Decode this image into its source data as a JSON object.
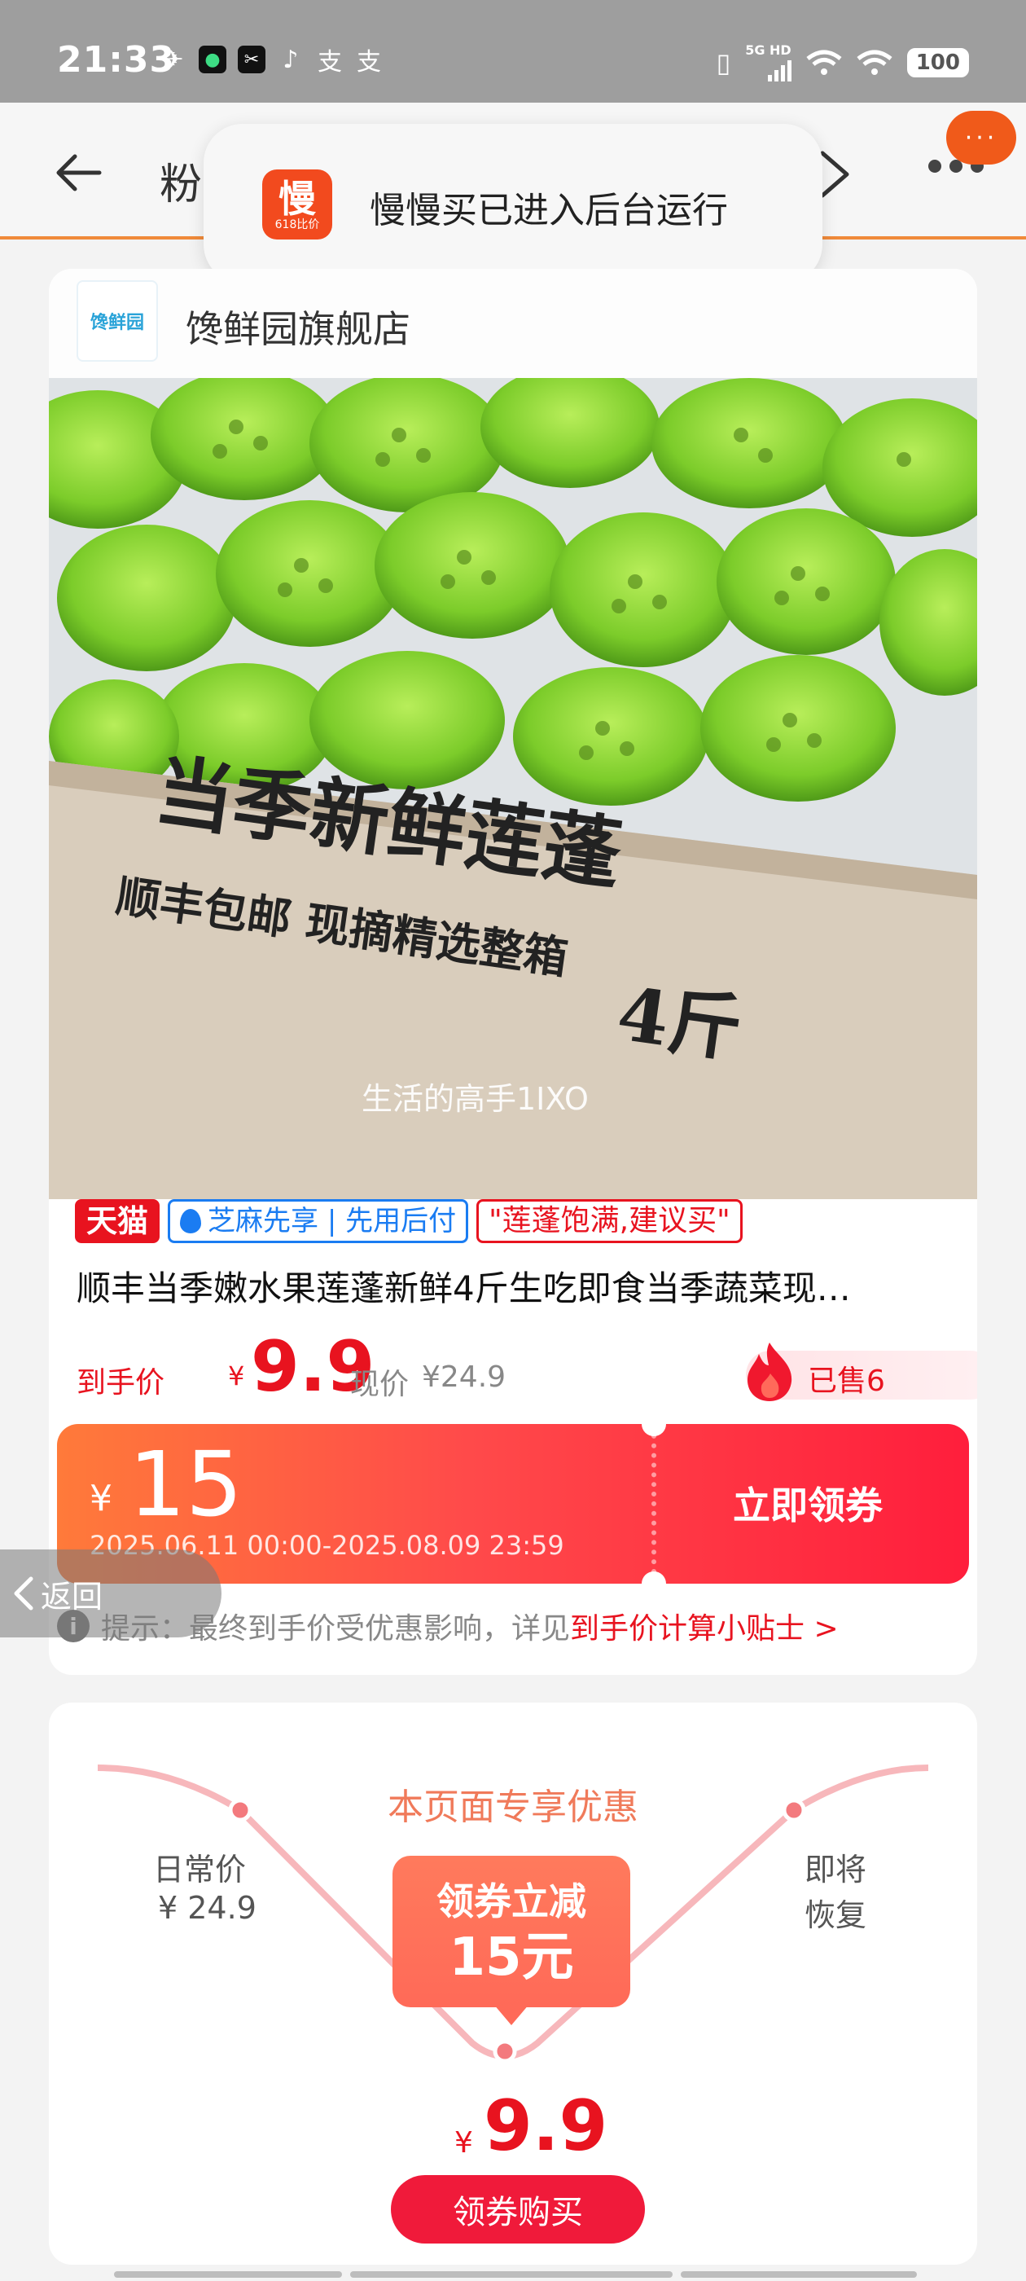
{
  "status_bar": {
    "time": "21:33",
    "network": "5G HD",
    "battery": "100",
    "app_icons": [
      "drone-icon",
      "app-green-icon",
      "capcut-icon",
      "tiktok-icon",
      "ticket-icon",
      "ticket-icon"
    ]
  },
  "nav": {
    "title": "粉"
  },
  "float_bubble": {
    "text": "···"
  },
  "toast": {
    "logo_text": "慢",
    "logo_sub": "618比价",
    "message": "慢慢买已进入后台运行"
  },
  "shop": {
    "logo_text": "馋鲜园",
    "name": "馋鲜园旗舰店"
  },
  "product_image": {
    "box_text_1": "当季新鲜莲蓬",
    "box_text_2": "顺丰包邮 现摘精选整箱",
    "box_text_3": "4斤",
    "watermark": "生活的高手1IXO"
  },
  "tags": {
    "tmall": "天猫",
    "sesame": "芝麻先享 | 先用后付",
    "quote": "\"莲蓬饱满,建议买\""
  },
  "product_title": "顺丰当季嫩水果莲蓬新鲜4斤生吃即食当季蔬菜现…",
  "price": {
    "label": "到手价",
    "yen": "¥",
    "value": "9.9",
    "orig_label": "现价",
    "orig_value": "¥24.9",
    "sold": "已售6"
  },
  "coupon": {
    "yen": "¥",
    "amount": "15",
    "validity": "2025.06.11 00:00-2025.08.09 23:59",
    "button": "立即领券"
  },
  "tip": {
    "icon": "i",
    "text": "提示：最终到手价受优惠影响，详见",
    "link": "到手价计算小贴士 >"
  },
  "float_back": {
    "label": "返回"
  },
  "promo": {
    "title": "本页面专享优惠",
    "daily_label": "日常价",
    "daily_price": "¥ 24.9",
    "restore_1": "即将",
    "restore_2": "恢复",
    "badge_line1": "领券立减",
    "badge_line2": "15元",
    "final_yen": "¥",
    "final_price": "9.9",
    "buy_button": "领券购买"
  },
  "colors": {
    "accent_red": "#e8131f",
    "nav_orange": "#f08a3a",
    "coupon_start": "#ff7a3a",
    "coupon_end": "#ff1e3c",
    "promo_line": "#f5a3a8"
  }
}
